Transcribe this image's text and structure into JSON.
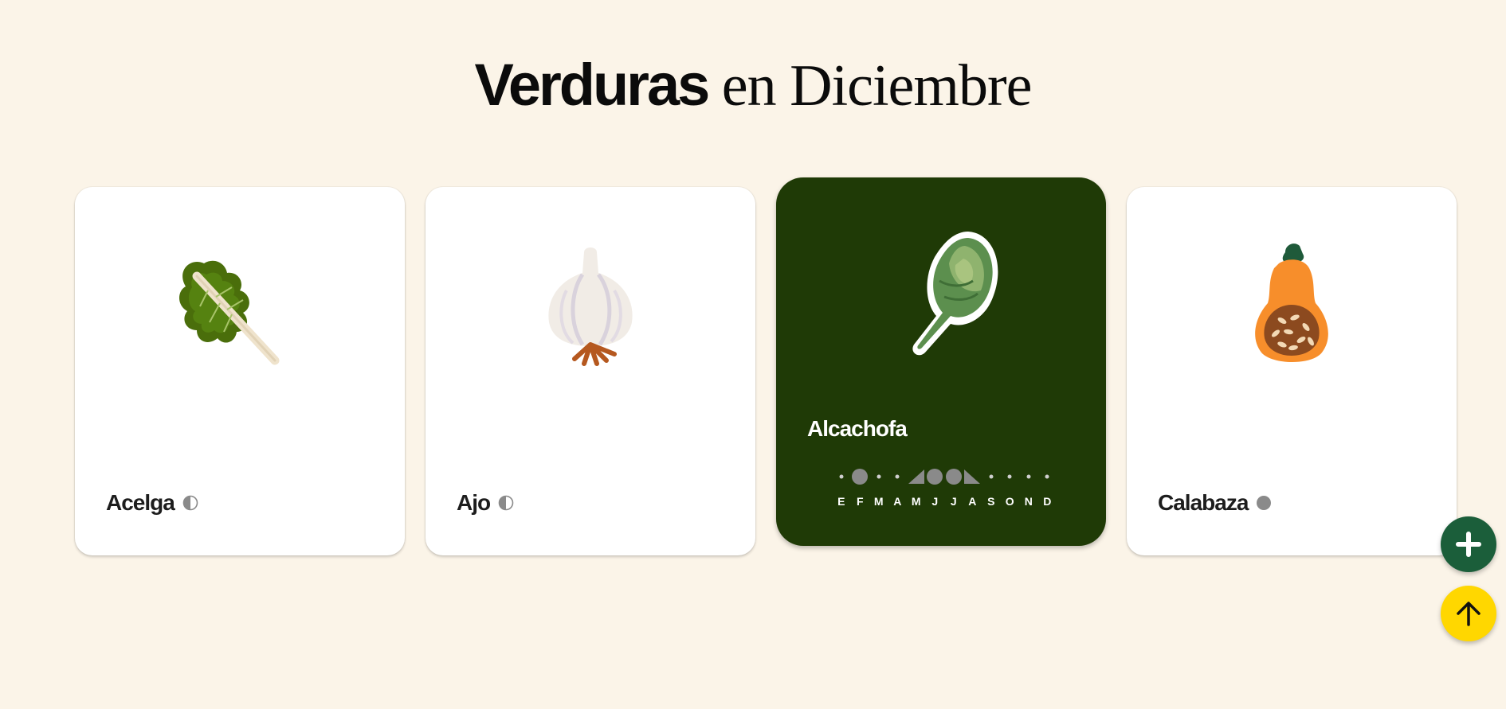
{
  "title": {
    "strong": "Verduras",
    "light": " en Diciembre"
  },
  "cards": [
    {
      "name": "Acelga",
      "season": "half",
      "icon": "chard-illustration"
    },
    {
      "name": "Ajo",
      "season": "half",
      "icon": "garlic-illustration"
    },
    {
      "name": "Alcachofa",
      "season": "calendar",
      "icon": "artichoke-illustration",
      "calendar": {
        "months": [
          "E",
          "F",
          "M",
          "A",
          "M",
          "J",
          "J",
          "A",
          "S",
          "O",
          "N",
          "D"
        ],
        "levels": [
          "dot",
          "full",
          "dot",
          "dot",
          "rising",
          "full",
          "full",
          "falling",
          "dot",
          "dot",
          "dot",
          "dot"
        ]
      }
    },
    {
      "name": "Calabaza",
      "season": "full",
      "icon": "squash-illustration"
    }
  ],
  "fabs": {
    "add_icon": "plus-icon",
    "top_icon": "arrow-up-icon"
  },
  "colors": {
    "background": "#fbf4e8",
    "active_card": "#1f3a06",
    "add_button": "#1b5e3a",
    "top_button": "#ffd700",
    "season_marker": "#8a8a8a"
  }
}
